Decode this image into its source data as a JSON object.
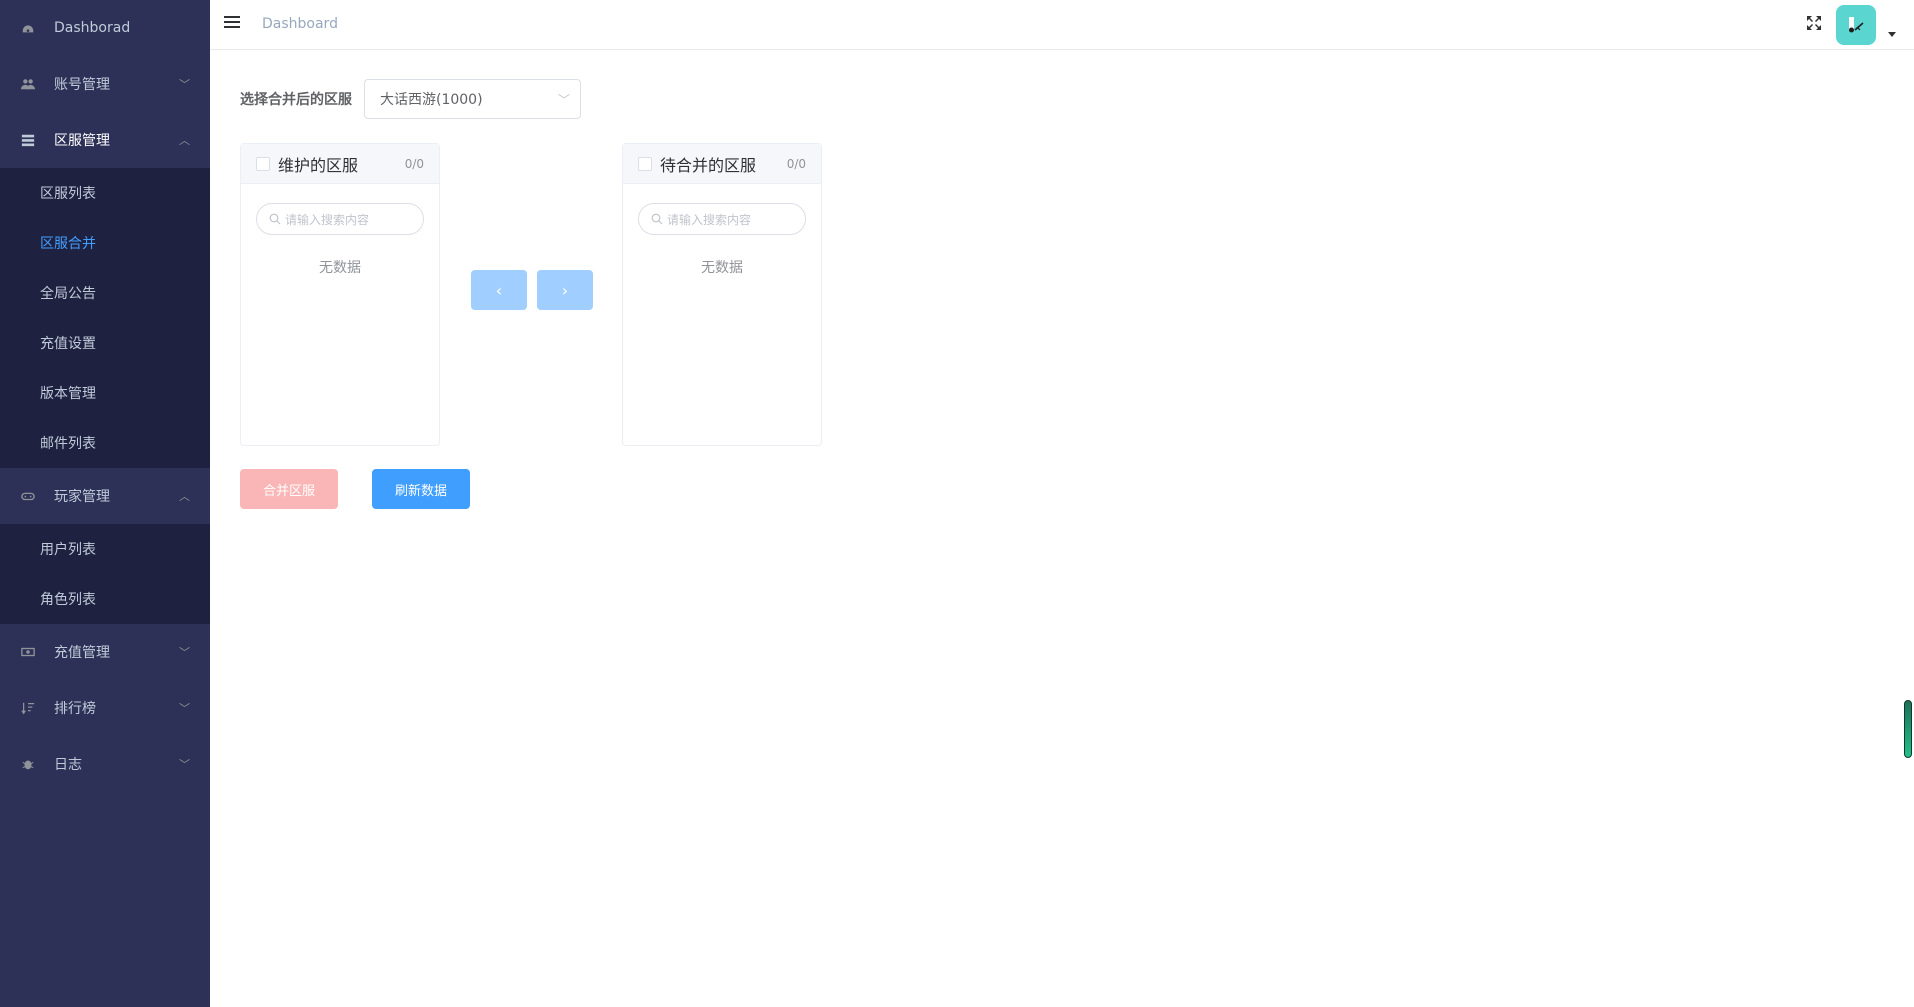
{
  "header": {
    "breadcrumb": "Dashboard"
  },
  "sidebar": {
    "items": [
      {
        "label": "Dashborad"
      },
      {
        "label": "账号管理"
      },
      {
        "label": "区服管理",
        "children": [
          "区服列表",
          "区服合并",
          "全局公告",
          "充值设置",
          "版本管理",
          "邮件列表"
        ]
      },
      {
        "label": "玩家管理",
        "children": [
          "用户列表",
          "角色列表"
        ]
      },
      {
        "label": "充值管理"
      },
      {
        "label": "排行榜"
      },
      {
        "label": "日志"
      }
    ]
  },
  "main": {
    "select_label": "选择合并后的区服",
    "select_value": "大话西游(1000)",
    "left_panel": {
      "title": "维护的区服",
      "count": "0/0",
      "search_placeholder": "请输入搜索内容",
      "empty": "无数据"
    },
    "right_panel": {
      "title": "待合并的区服",
      "count": "0/0",
      "search_placeholder": "请输入搜索内容",
      "empty": "无数据"
    },
    "merge_button": "合并区服",
    "refresh_button": "刷新数据"
  },
  "colors": {
    "sidebar_bg": "#2d3157",
    "submenu_bg": "#1f2140",
    "active_text": "#409eff",
    "primary": "#409eff",
    "danger_disabled": "#fab6b6"
  }
}
